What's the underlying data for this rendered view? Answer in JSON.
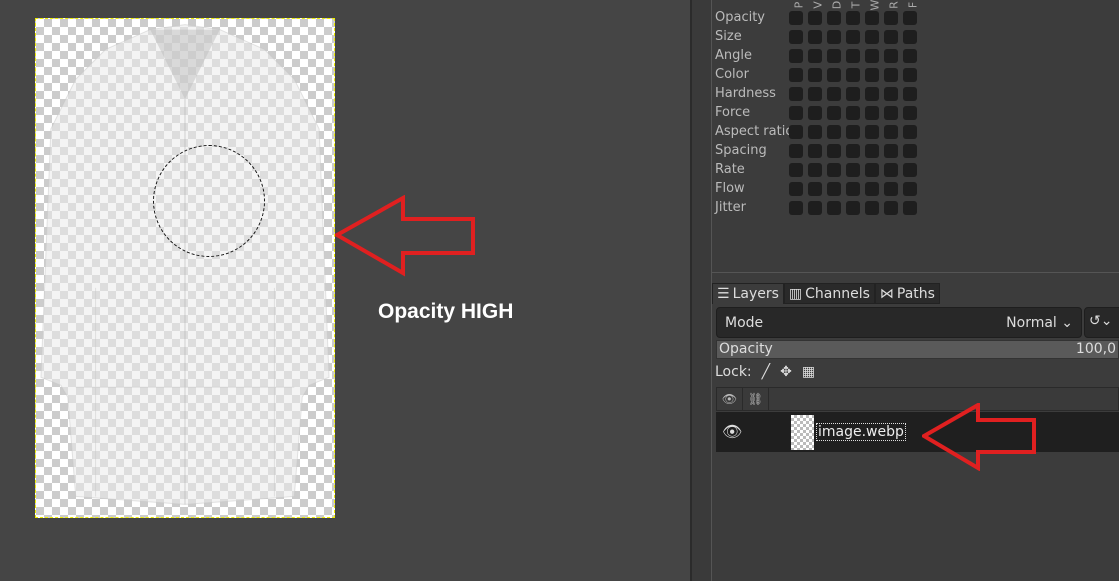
{
  "annotation": {
    "text": "Opacity HIGH",
    "arrow_color": "#e02020"
  },
  "dynamics": {
    "columns": [
      "P",
      "V",
      "D",
      "T",
      "W",
      "R",
      "F"
    ],
    "rows": [
      "Opacity",
      "Size",
      "Angle",
      "Color",
      "Hardness",
      "Force",
      "Aspect ratio",
      "Spacing",
      "Rate",
      "Flow",
      "Jitter"
    ]
  },
  "tabs": [
    {
      "label": "Layers",
      "icon": "layers-icon"
    },
    {
      "label": "Channels",
      "icon": "channels-icon"
    },
    {
      "label": "Paths",
      "icon": "paths-icon"
    }
  ],
  "mode": {
    "label": "Mode",
    "value": "Normal"
  },
  "opacity": {
    "label": "Opacity",
    "value": "100,0"
  },
  "lock": {
    "label": "Lock:"
  },
  "layers": [
    {
      "name": "image.webp",
      "visible": true
    }
  ]
}
